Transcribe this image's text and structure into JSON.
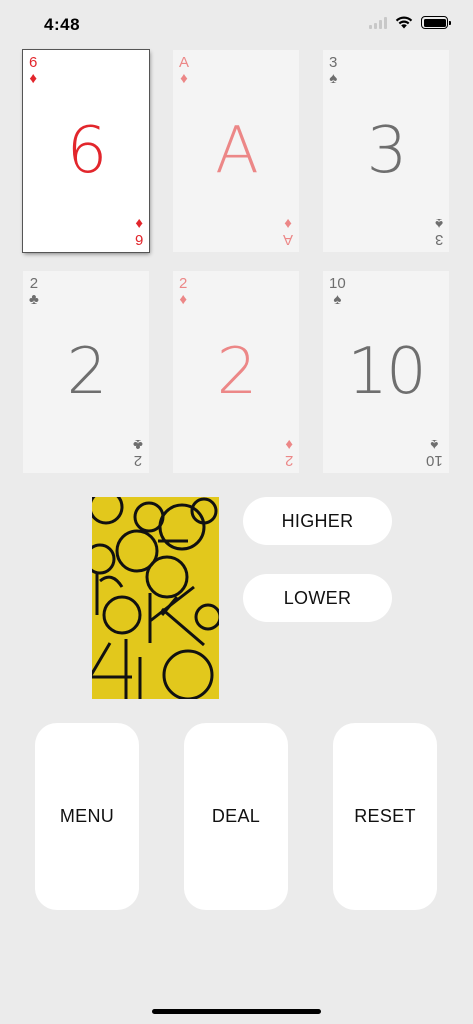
{
  "status_bar": {
    "time": "4:48",
    "wifi_icon": "wifi-icon",
    "battery_icon": "battery-icon"
  },
  "cards": [
    {
      "rank": "6",
      "suit": "♦",
      "suit_name": "diamonds",
      "color_class": "red",
      "selected": true
    },
    {
      "rank": "A",
      "suit": "♦",
      "suit_name": "diamonds",
      "color_class": "pink",
      "selected": false
    },
    {
      "rank": "3",
      "suit": "♠",
      "suit_name": "spades",
      "color_class": "gray",
      "selected": false
    },
    {
      "rank": "2",
      "suit": "♣",
      "suit_name": "clubs",
      "color_class": "gray",
      "selected": false
    },
    {
      "rank": "2",
      "suit": "♦",
      "suit_name": "diamonds",
      "color_class": "pink",
      "selected": false
    },
    {
      "rank": "10",
      "suit": "♠",
      "suit_name": "spades",
      "color_class": "gray",
      "selected": false
    }
  ],
  "deck": {
    "background": "#e2c81c"
  },
  "guess": {
    "higher_label": "HIGHER",
    "lower_label": "LOWER"
  },
  "controls": {
    "menu_label": "MENU",
    "deal_label": "DEAL",
    "reset_label": "RESET"
  },
  "colors": {
    "background": "#ebebeb",
    "red_suit": "#e2262c",
    "faded_red": "#ec8787",
    "black_suit": "#6e6e6e",
    "deck_yellow": "#e2c81c"
  }
}
